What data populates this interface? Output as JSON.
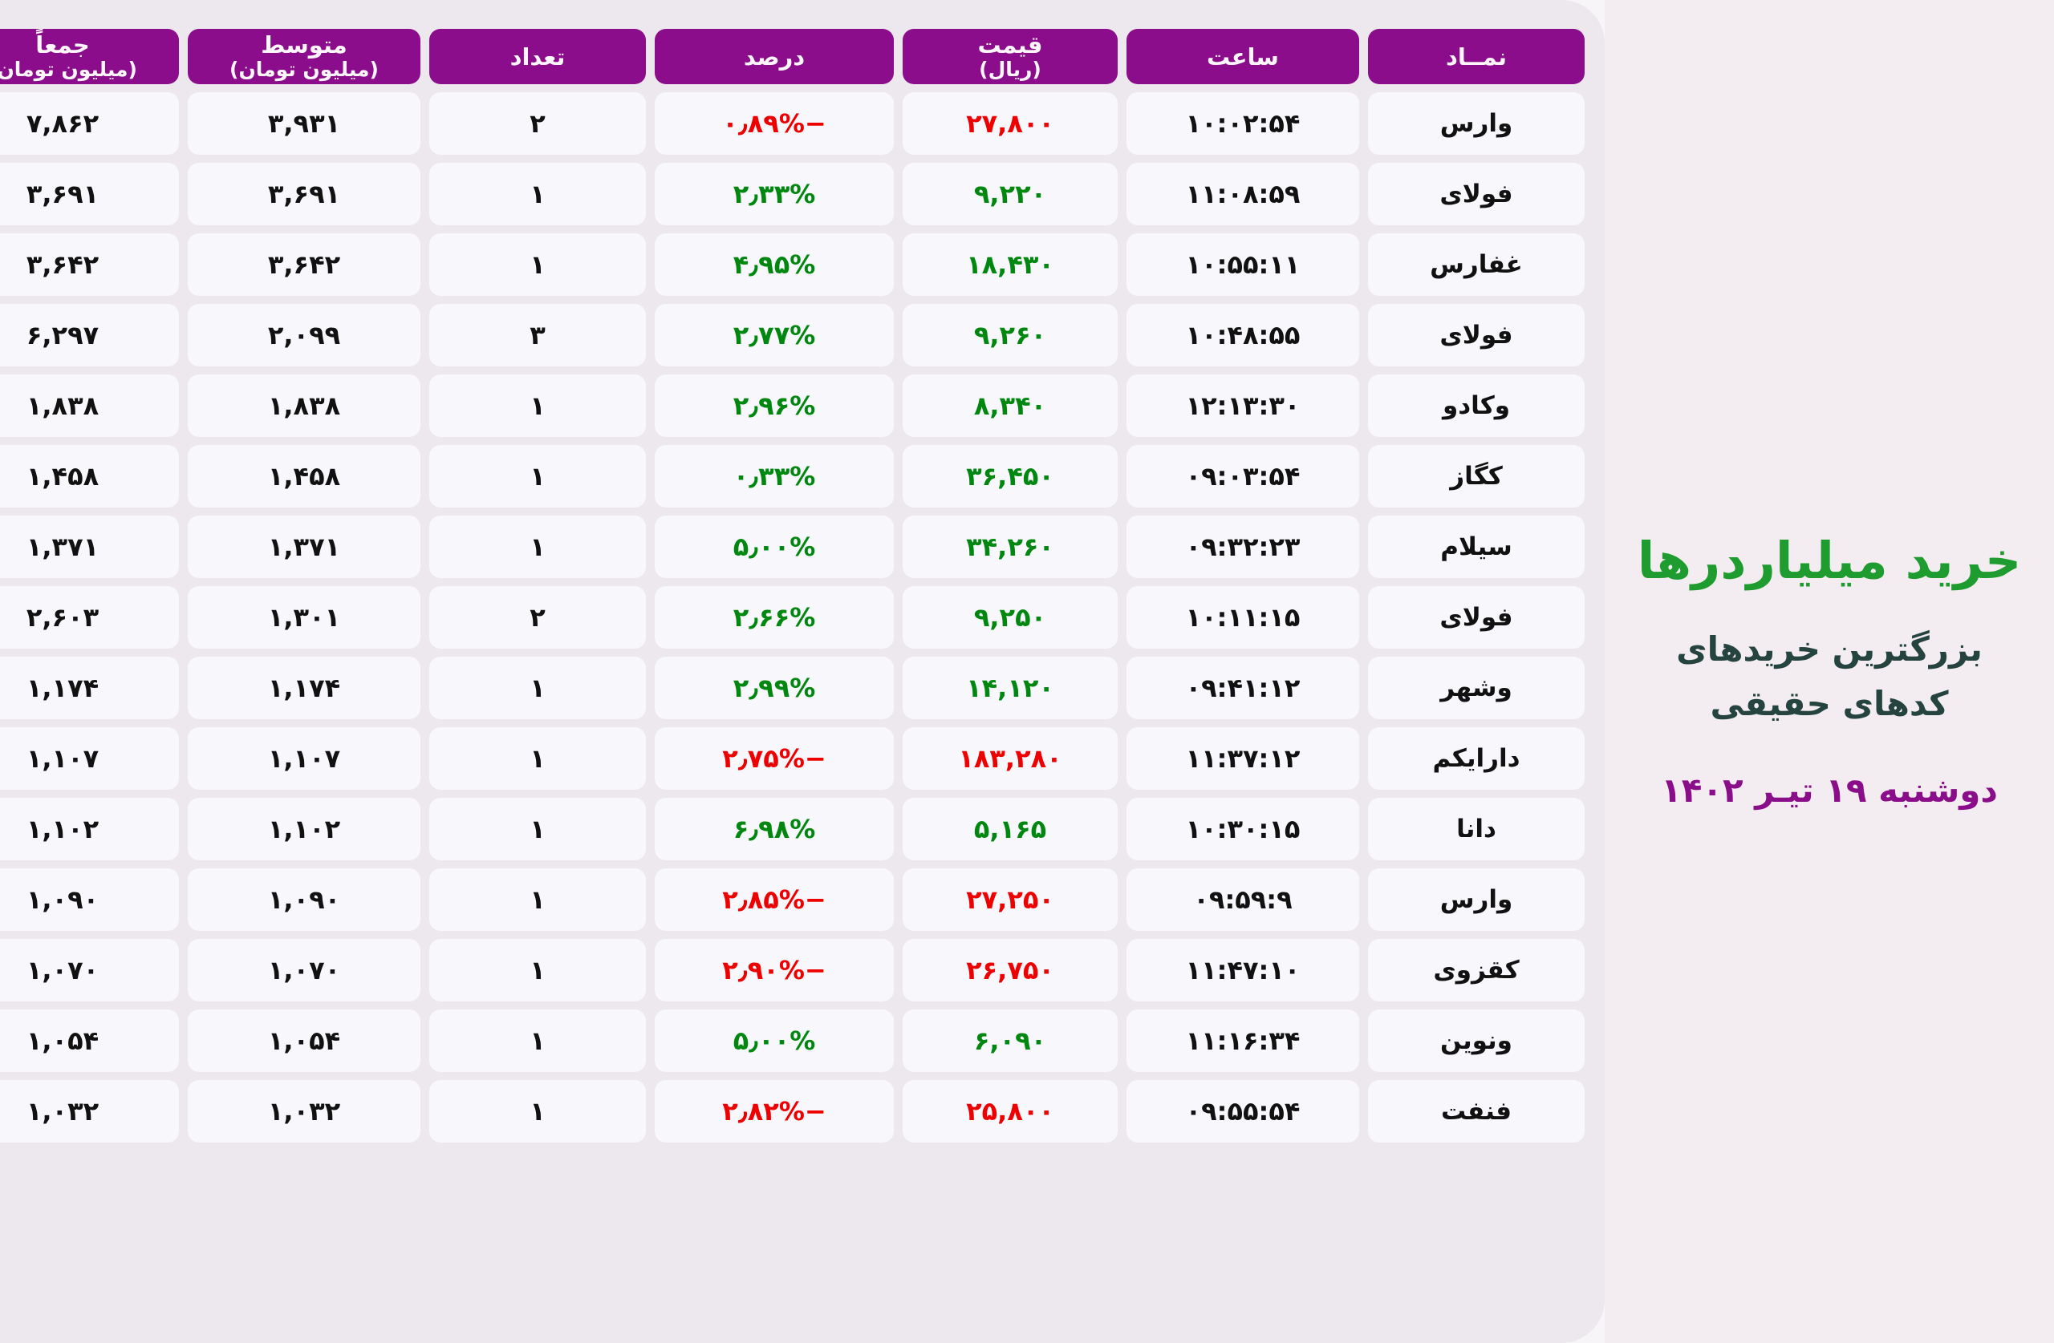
{
  "title_panel": {
    "heading": "خرید میلیاردرها",
    "subtitle_line1": "بزرگترین خریدهای",
    "subtitle_line2": "کدهای حقیقی",
    "date": "دوشنبه ۱۹ تیـر ۱۴۰۲",
    "colors": {
      "heading": "#1f9c2f",
      "subtitle": "#26443f",
      "date": "#8a0d8a",
      "panel_bg": "#f3ecf1"
    }
  },
  "table": {
    "accent_header_bg": "#8c0d8c",
    "cell_bg": "#f8f7fc",
    "grid_bg": "#ede8ee",
    "up_color": "#00870f",
    "down_color": "#ef0000",
    "columns": [
      {
        "key": "symbol",
        "label": "نمــاد",
        "unit": ""
      },
      {
        "key": "time",
        "label": "ساعت",
        "unit": ""
      },
      {
        "key": "price",
        "label": "قیمت",
        "unit": "(ریال)"
      },
      {
        "key": "percent",
        "label": "درصد",
        "unit": ""
      },
      {
        "key": "count",
        "label": "تعداد",
        "unit": ""
      },
      {
        "key": "average",
        "label": "متوسط",
        "unit": "(میلیون تومان)"
      },
      {
        "key": "total",
        "label": "جمعاً",
        "unit": "(میلیون تومان)"
      }
    ],
    "rows": [
      {
        "symbol": "وارس",
        "time": "۱۰:۰۲:۵۴",
        "price": "۲۷,۸۰۰",
        "percent": "−۰٫۸۹%",
        "dir": "down",
        "count": "۲",
        "average": "۳,۹۳۱",
        "total": "۷,۸۶۲"
      },
      {
        "symbol": "فولای",
        "time": "۱۱:۰۸:۵۹",
        "price": "۹,۲۲۰",
        "percent": "۲٫۳۳%",
        "dir": "up",
        "count": "۱",
        "average": "۳,۶۹۱",
        "total": "۳,۶۹۱"
      },
      {
        "symbol": "غفارس",
        "time": "۱۰:۵۵:۱۱",
        "price": "۱۸,۴۳۰",
        "percent": "۴٫۹۵%",
        "dir": "up",
        "count": "۱",
        "average": "۳,۶۴۲",
        "total": "۳,۶۴۲"
      },
      {
        "symbol": "فولای",
        "time": "۱۰:۴۸:۵۵",
        "price": "۹,۲۶۰",
        "percent": "۲٫۷۷%",
        "dir": "up",
        "count": "۳",
        "average": "۲,۰۹۹",
        "total": "۶,۲۹۷"
      },
      {
        "symbol": "وکادو",
        "time": "۱۲:۱۳:۳۰",
        "price": "۸,۳۴۰",
        "percent": "۲٫۹۶%",
        "dir": "up",
        "count": "۱",
        "average": "۱,۸۳۸",
        "total": "۱,۸۳۸"
      },
      {
        "symbol": "کگاز",
        "time": "۰۹:۰۳:۵۴",
        "price": "۳۶,۴۵۰",
        "percent": "۰٫۳۳%",
        "dir": "up",
        "count": "۱",
        "average": "۱,۴۵۸",
        "total": "۱,۴۵۸"
      },
      {
        "symbol": "سیلام",
        "time": "۰۹:۳۲:۲۳",
        "price": "۳۴,۲۶۰",
        "percent": "۵٫۰۰%",
        "dir": "up",
        "count": "۱",
        "average": "۱,۳۷۱",
        "total": "۱,۳۷۱"
      },
      {
        "symbol": "فولای",
        "time": "۱۰:۱۱:۱۵",
        "price": "۹,۲۵۰",
        "percent": "۲٫۶۶%",
        "dir": "up",
        "count": "۲",
        "average": "۱,۳۰۱",
        "total": "۲,۶۰۳"
      },
      {
        "symbol": "وشهر",
        "time": "۰۹:۴۱:۱۲",
        "price": "۱۴,۱۲۰",
        "percent": "۲٫۹۹%",
        "dir": "up",
        "count": "۱",
        "average": "۱,۱۷۴",
        "total": "۱,۱۷۴"
      },
      {
        "symbol": "دارا‌یکم",
        "time": "۱۱:۳۷:۱۲",
        "price": "۱۸۳,۲۸۰",
        "percent": "−۲٫۷۵%",
        "dir": "down",
        "count": "۱",
        "average": "۱,۱۰۷",
        "total": "۱,۱۰۷"
      },
      {
        "symbol": "دانا",
        "time": "۱۰:۳۰:۱۵",
        "price": "۵,۱۶۵",
        "percent": "۶٫۹۸%",
        "dir": "up",
        "count": "۱",
        "average": "۱,۱۰۲",
        "total": "۱,۱۰۲"
      },
      {
        "symbol": "وارس",
        "time": "۰۹:۵۹:۹",
        "price": "۲۷,۲۵۰",
        "percent": "−۲٫۸۵%",
        "dir": "down",
        "count": "۱",
        "average": "۱,۰۹۰",
        "total": "۱,۰۹۰"
      },
      {
        "symbol": "کقزوی",
        "time": "۱۱:۴۷:۱۰",
        "price": "۲۶,۷۵۰",
        "percent": "−۲٫۹۰%",
        "dir": "down",
        "count": "۱",
        "average": "۱,۰۷۰",
        "total": "۱,۰۷۰"
      },
      {
        "symbol": "ونوین",
        "time": "۱۱:۱۶:۳۴",
        "price": "۶,۰۹۰",
        "percent": "۵٫۰۰%",
        "dir": "up",
        "count": "۱",
        "average": "۱,۰۵۴",
        "total": "۱,۰۵۴"
      },
      {
        "symbol": "فنفت",
        "time": "۰۹:۵۵:۵۴",
        "price": "۲۵,۸۰۰",
        "percent": "−۲٫۸۲%",
        "dir": "down",
        "count": "۱",
        "average": "۱,۰۳۲",
        "total": "۱,۰۳۲"
      }
    ]
  }
}
